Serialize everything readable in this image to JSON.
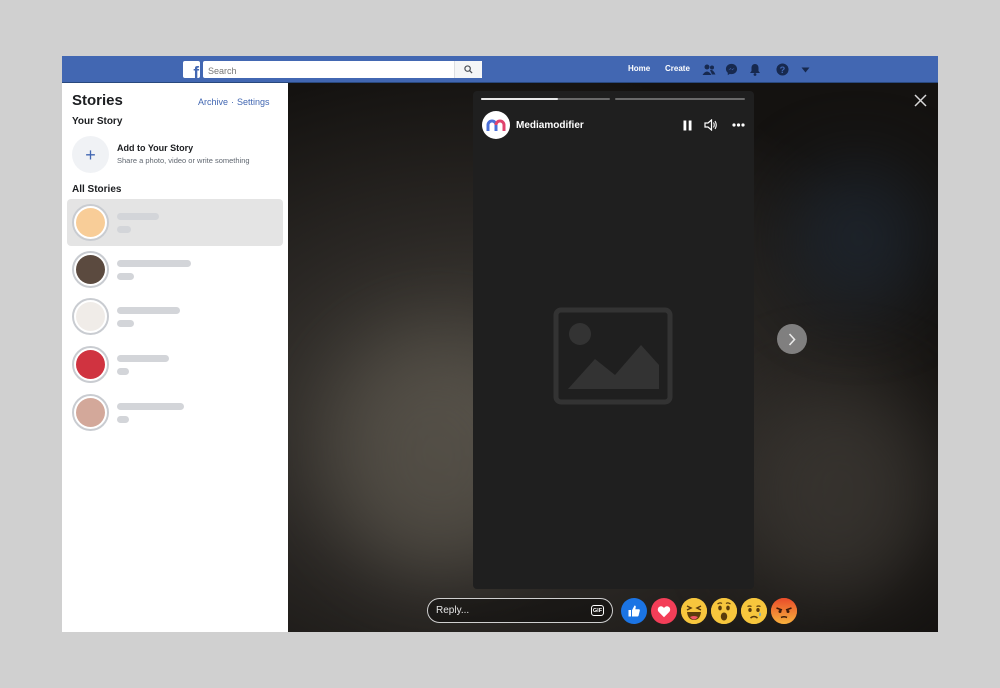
{
  "header": {
    "search_placeholder": "Search",
    "nav": {
      "home": "Home",
      "create": "Create"
    },
    "icons": [
      "friends-icon",
      "messenger-icon",
      "notifications-icon",
      "help-icon",
      "account-menu-icon"
    ],
    "brand_color": "#4267b2"
  },
  "sidebar": {
    "title": "Stories",
    "archive": "Archive",
    "settings": "Settings",
    "separator": "·",
    "your_story": "Your Story",
    "add_story": {
      "icon": "+",
      "title": "Add to Your Story",
      "subtitle": "Share a photo, video or write something"
    },
    "all_stories": "All Stories",
    "stories": [
      {
        "color": "#f8cd98",
        "selected": true
      },
      {
        "color": "#5b4a3f",
        "selected": false
      },
      {
        "color": "#f0ece8",
        "selected": false
      },
      {
        "color": "#d03340",
        "selected": false
      },
      {
        "color": "#d3a89a",
        "selected": false
      }
    ]
  },
  "viewer": {
    "username": "Mediamodifier",
    "progress": [
      0.6,
      0
    ],
    "reply_placeholder": "Reply...",
    "gif_label": "GIF",
    "reactions": [
      "like",
      "love",
      "haha",
      "wow",
      "sad",
      "angry"
    ]
  }
}
